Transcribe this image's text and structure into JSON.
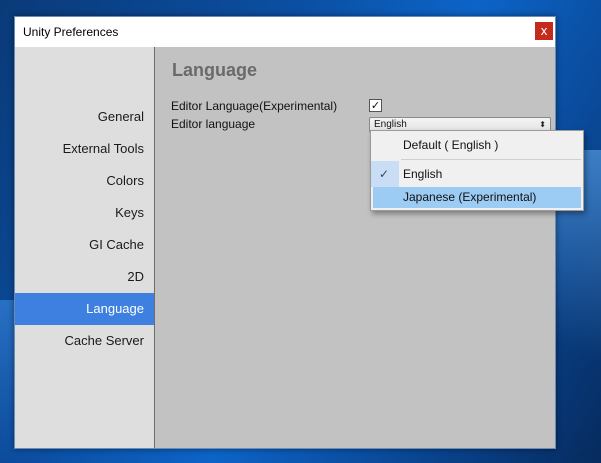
{
  "window": {
    "title": "Unity Preferences",
    "close_label": "x"
  },
  "sidebar": {
    "items": [
      {
        "label": "General"
      },
      {
        "label": "External Tools"
      },
      {
        "label": "Colors"
      },
      {
        "label": "Keys"
      },
      {
        "label": "GI Cache"
      },
      {
        "label": "2D"
      },
      {
        "label": "Language",
        "active": true
      },
      {
        "label": "Cache Server"
      }
    ]
  },
  "language_panel": {
    "heading": "Language",
    "editor_language_experimental_label": "Editor Language(Experimental)",
    "editor_language_experimental_checked": true,
    "checkmark": "✓",
    "editor_language_label": "Editor language",
    "editor_language_value": "English",
    "select_arrow": "⬍"
  },
  "language_dropdown": {
    "options": [
      {
        "label": "Default ( English )",
        "selected": false,
        "highlighted": false
      },
      {
        "label": "English",
        "selected": true,
        "highlighted": false
      },
      {
        "label": "Japanese (Experimental)",
        "selected": false,
        "highlighted": true
      }
    ],
    "check_glyph": "✓"
  },
  "colors": {
    "sidebar_active": "#3d80df",
    "content_bg": "#c2c2c2",
    "sidebar_bg": "#dedede",
    "highlight": "#9ccbf3",
    "close_button": "#c42b1c"
  }
}
